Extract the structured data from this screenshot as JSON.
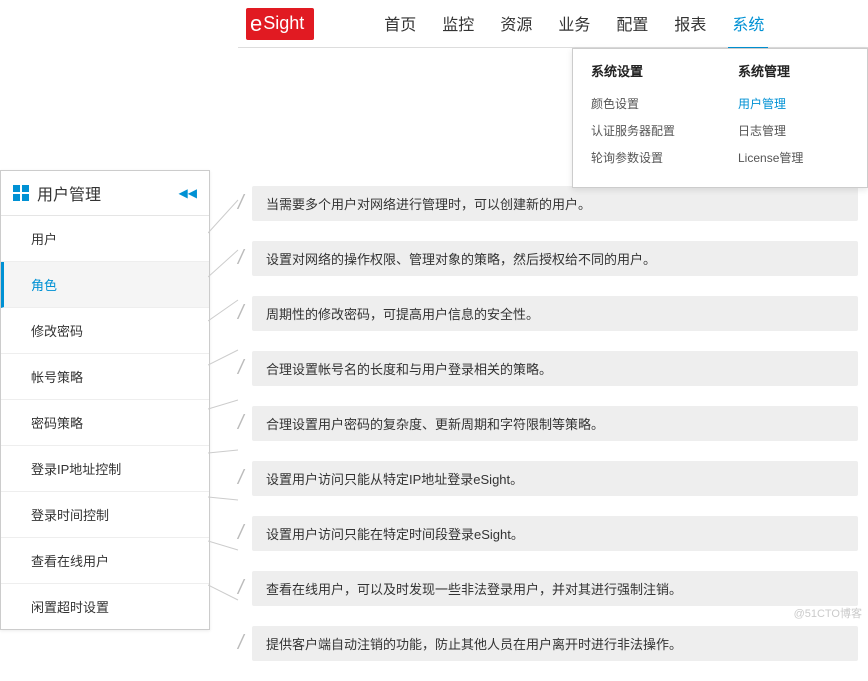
{
  "logo": {
    "prefix": "e",
    "text": "Sight"
  },
  "nav": {
    "items": [
      "首页",
      "监控",
      "资源",
      "业务",
      "配置",
      "报表",
      "系统"
    ],
    "activeIndex": 6
  },
  "dropdown": {
    "col1": {
      "header": "系统设置",
      "items": [
        "颜色设置",
        "认证服务器配置",
        "轮询参数设置"
      ]
    },
    "col2": {
      "header": "系统管理",
      "items": [
        "用户管理",
        "日志管理",
        "License管理"
      ],
      "highlightIndex": 0
    }
  },
  "sidebar": {
    "title": "用户管理",
    "items": [
      "用户",
      "角色",
      "修改密码",
      "帐号策略",
      "密码策略",
      "登录IP地址控制",
      "登录时间控制",
      "查看在线用户",
      "闲置超时设置"
    ],
    "activeIndex": 1
  },
  "descriptions": [
    "当需要多个用户对网络进行管理时，可以创建新的用户。",
    "设置对网络的操作权限、管理对象的策略，然后授权给不同的用户。",
    "周期性的修改密码，可提高用户信息的安全性。",
    "合理设置帐号名的长度和与用户登录相关的策略。",
    "合理设置用户密码的复杂度、更新周期和字符限制等策略。",
    "设置用户访问只能从特定IP地址登录eSight。",
    "设置用户访问只能在特定时间段登录eSight。",
    "查看在线用户，可以及时发现一些非法登录用户，并对其进行强制注销。",
    "提供客户端自动注销的功能，防止其他人员在用户离开时进行非法操作。"
  ],
  "watermark": "@51CTO博客"
}
